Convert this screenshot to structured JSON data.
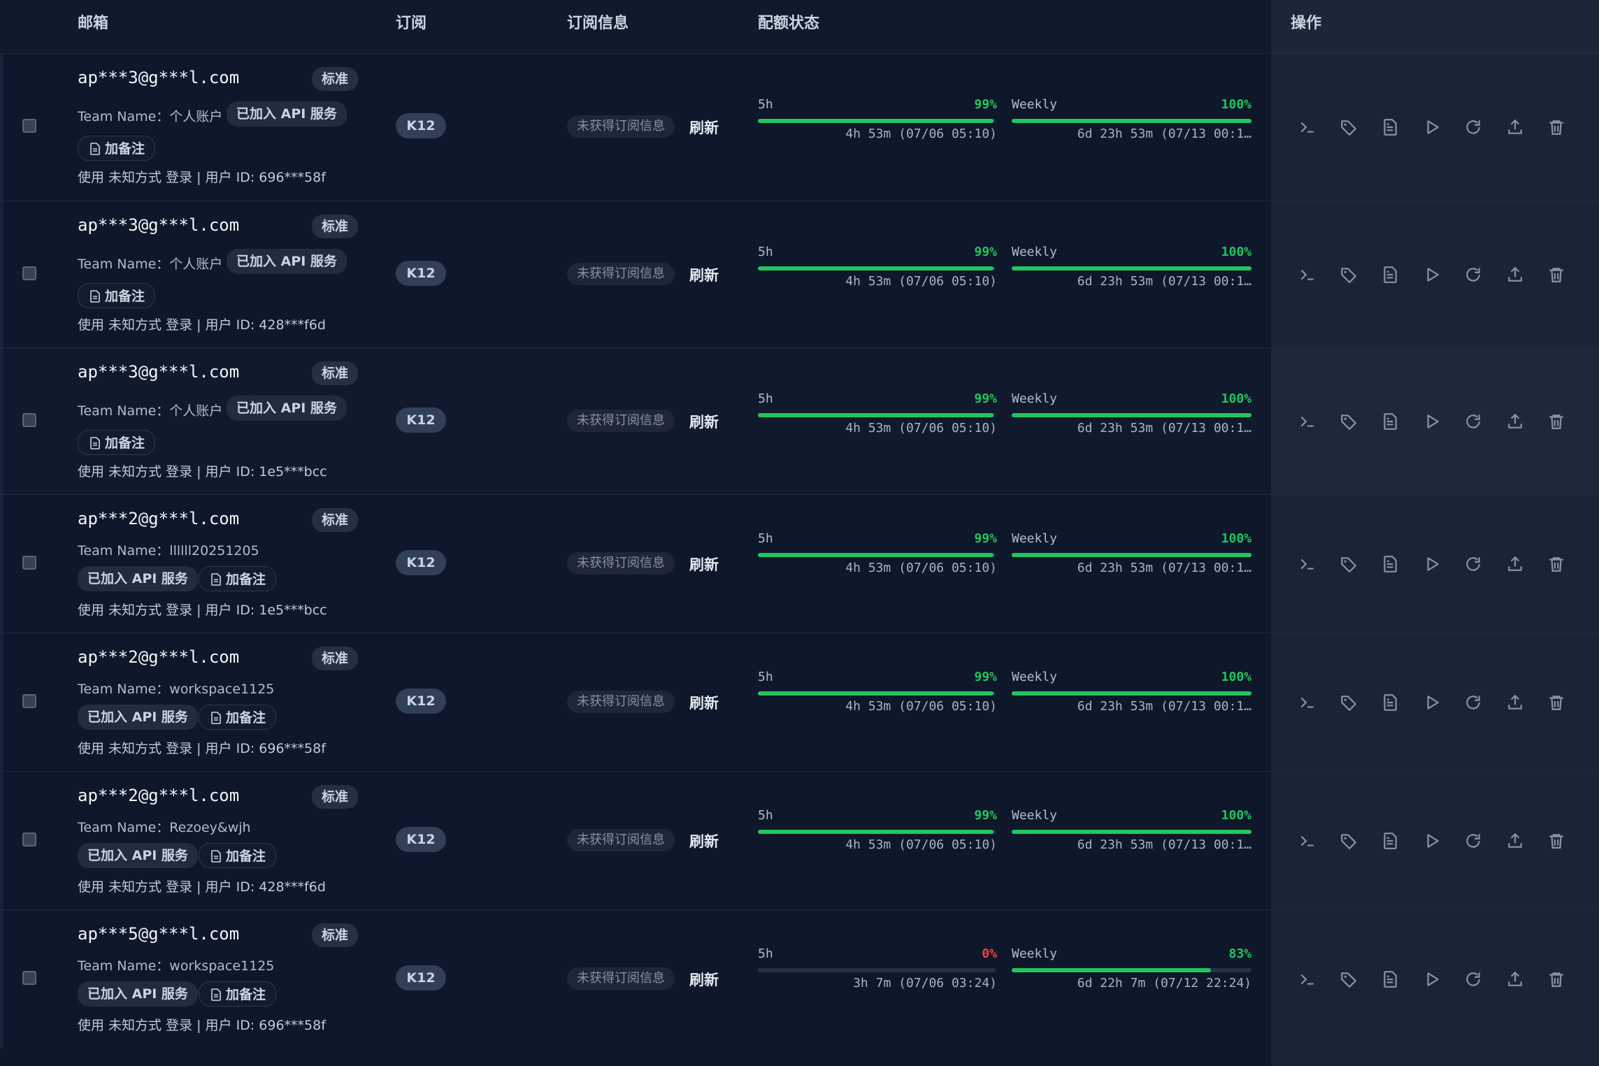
{
  "header": {
    "email": "邮箱",
    "plan": "订阅",
    "sub_info": "订阅信息",
    "quota": "配额状态",
    "ops": "操作"
  },
  "labels": {
    "refresh": "刷新",
    "no_sub": "未获得订阅信息",
    "note": "加备注",
    "api": "已加入 API 服务",
    "std": "标准",
    "five_h": "5h",
    "weekly": "Weekly"
  },
  "rows": [
    {
      "email": "ap***3@g***l.com",
      "team": "Team Name：个人账户",
      "login": "使用 未知方式 登录 | 用户 ID: 696***58f",
      "plan": "K12",
      "q5_pct": "99%",
      "q5_fill": 0.99,
      "q5_color": "#22c55e",
      "q5_reset": "4h 53m (07/06 05:10)",
      "qw_pct": "100%",
      "qw_fill": 1.0,
      "qw_reset": "6d 23h 53m (07/13 00:1…"
    },
    {
      "email": "ap***3@g***l.com",
      "team": "Team Name：个人账户",
      "login": "使用 未知方式 登录 | 用户 ID: 428***f6d",
      "plan": "K12",
      "q5_pct": "99%",
      "q5_fill": 0.99,
      "q5_color": "#22c55e",
      "q5_reset": "4h 53m (07/06 05:10)",
      "qw_pct": "100%",
      "qw_fill": 1.0,
      "qw_reset": "6d 23h 53m (07/13 00:1…"
    },
    {
      "email": "ap***3@g***l.com",
      "team": "Team Name：个人账户",
      "login": "使用 未知方式 登录 | 用户 ID: 1e5***bcc",
      "plan": "K12",
      "q5_pct": "99%",
      "q5_fill": 0.99,
      "q5_color": "#22c55e",
      "q5_reset": "4h 53m (07/06 05:10)",
      "qw_pct": "100%",
      "qw_fill": 1.0,
      "qw_reset": "6d 23h 53m (07/13 00:1…"
    },
    {
      "email": "ap***2@g***l.com",
      "team": "Team Name：llllll20251205",
      "login": "使用 未知方式 登录 | 用户 ID: 1e5***bcc",
      "plan": "K12",
      "q5_pct": "99%",
      "q5_fill": 0.99,
      "q5_color": "#22c55e",
      "q5_reset": "4h 53m (07/06 05:10)",
      "qw_pct": "100%",
      "qw_fill": 1.0,
      "qw_reset": "6d 23h 53m (07/13 00:1…"
    },
    {
      "email": "ap***2@g***l.com",
      "team": "Team Name：workspace1125",
      "login": "使用 未知方式 登录 | 用户 ID: 696***58f",
      "plan": "K12",
      "q5_pct": "99%",
      "q5_fill": 0.99,
      "q5_color": "#22c55e",
      "q5_reset": "4h 53m (07/06 05:10)",
      "qw_pct": "100%",
      "qw_fill": 1.0,
      "qw_reset": "6d 23h 53m (07/13 00:1…"
    },
    {
      "email": "ap***2@g***l.com",
      "team": "Team Name：Rezoey&wjh",
      "login": "使用 未知方式 登录 | 用户 ID: 428***f6d",
      "plan": "K12",
      "q5_pct": "99%",
      "q5_fill": 0.99,
      "q5_color": "#22c55e",
      "q5_reset": "4h 53m (07/06 05:10)",
      "qw_pct": "100%",
      "qw_fill": 1.0,
      "qw_reset": "6d 23h 53m (07/13 00:1…"
    },
    {
      "email": "ap***5@g***l.com",
      "team": "Team Name：workspace1125",
      "login": "使用 未知方式 登录 | 用户 ID: 696***58f",
      "plan": "K12",
      "q5_pct": "0%",
      "q5_fill": 0.0,
      "q5_color": "#ef4444",
      "q5_reset": "3h 7m (07/06 03:24)",
      "qw_pct": "83%",
      "qw_fill": 0.83,
      "qw_reset": "6d 22h 7m (07/12 22:24)"
    }
  ],
  "icons": [
    "terminal-icon",
    "tag-icon",
    "document-icon",
    "play-icon",
    "refresh-icon",
    "upload-icon",
    "trash-icon"
  ]
}
